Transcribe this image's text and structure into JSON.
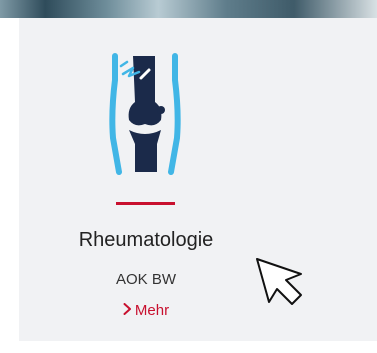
{
  "card": {
    "icon": "knee-joint-icon",
    "title": "Rheumatologie",
    "subtitle": "AOK BW",
    "link": {
      "label": "Mehr",
      "icon": "chevron-right-icon"
    }
  },
  "colors": {
    "accent": "#c8102e",
    "icon_dark": "#1b2a4a",
    "icon_light": "#41b6e6",
    "card_bg": "#f1f2f4"
  },
  "pointer": "mouse-cursor-icon"
}
